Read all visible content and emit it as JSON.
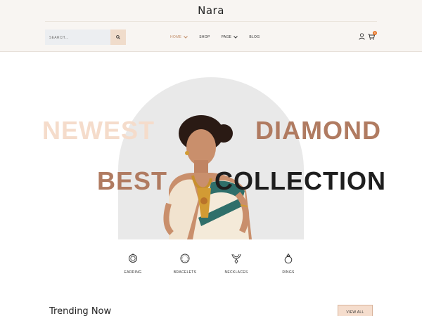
{
  "header": {
    "brand": "Nara",
    "search": {
      "placeholder": "SEARCH..."
    },
    "nav": [
      {
        "label": "HOME",
        "active": true,
        "has_dropdown": true
      },
      {
        "label": "SHOP",
        "active": false,
        "has_dropdown": false
      },
      {
        "label": "PAGE",
        "active": false,
        "has_dropdown": true
      },
      {
        "label": "BLOG",
        "active": false,
        "has_dropdown": false
      }
    ],
    "cart_count": "0"
  },
  "hero": {
    "word1": "NEWEST",
    "word2": "DIAMOND",
    "word3": "BEST",
    "word4": "COLLECTION"
  },
  "categories": [
    {
      "label": "EARRING",
      "icon": "earring-icon"
    },
    {
      "label": "BRACELETS",
      "icon": "bracelet-icon"
    },
    {
      "label": "NECKLACES",
      "icon": "necklace-icon"
    },
    {
      "label": "RINGS",
      "icon": "ring-icon"
    }
  ],
  "trending": {
    "title": "Trending Now",
    "view_all": "VIEW ALL"
  },
  "colors": {
    "accent": "#c08a64",
    "brown": "#b07b61",
    "peach": "#f5dccb",
    "badge": "#e7762a"
  }
}
